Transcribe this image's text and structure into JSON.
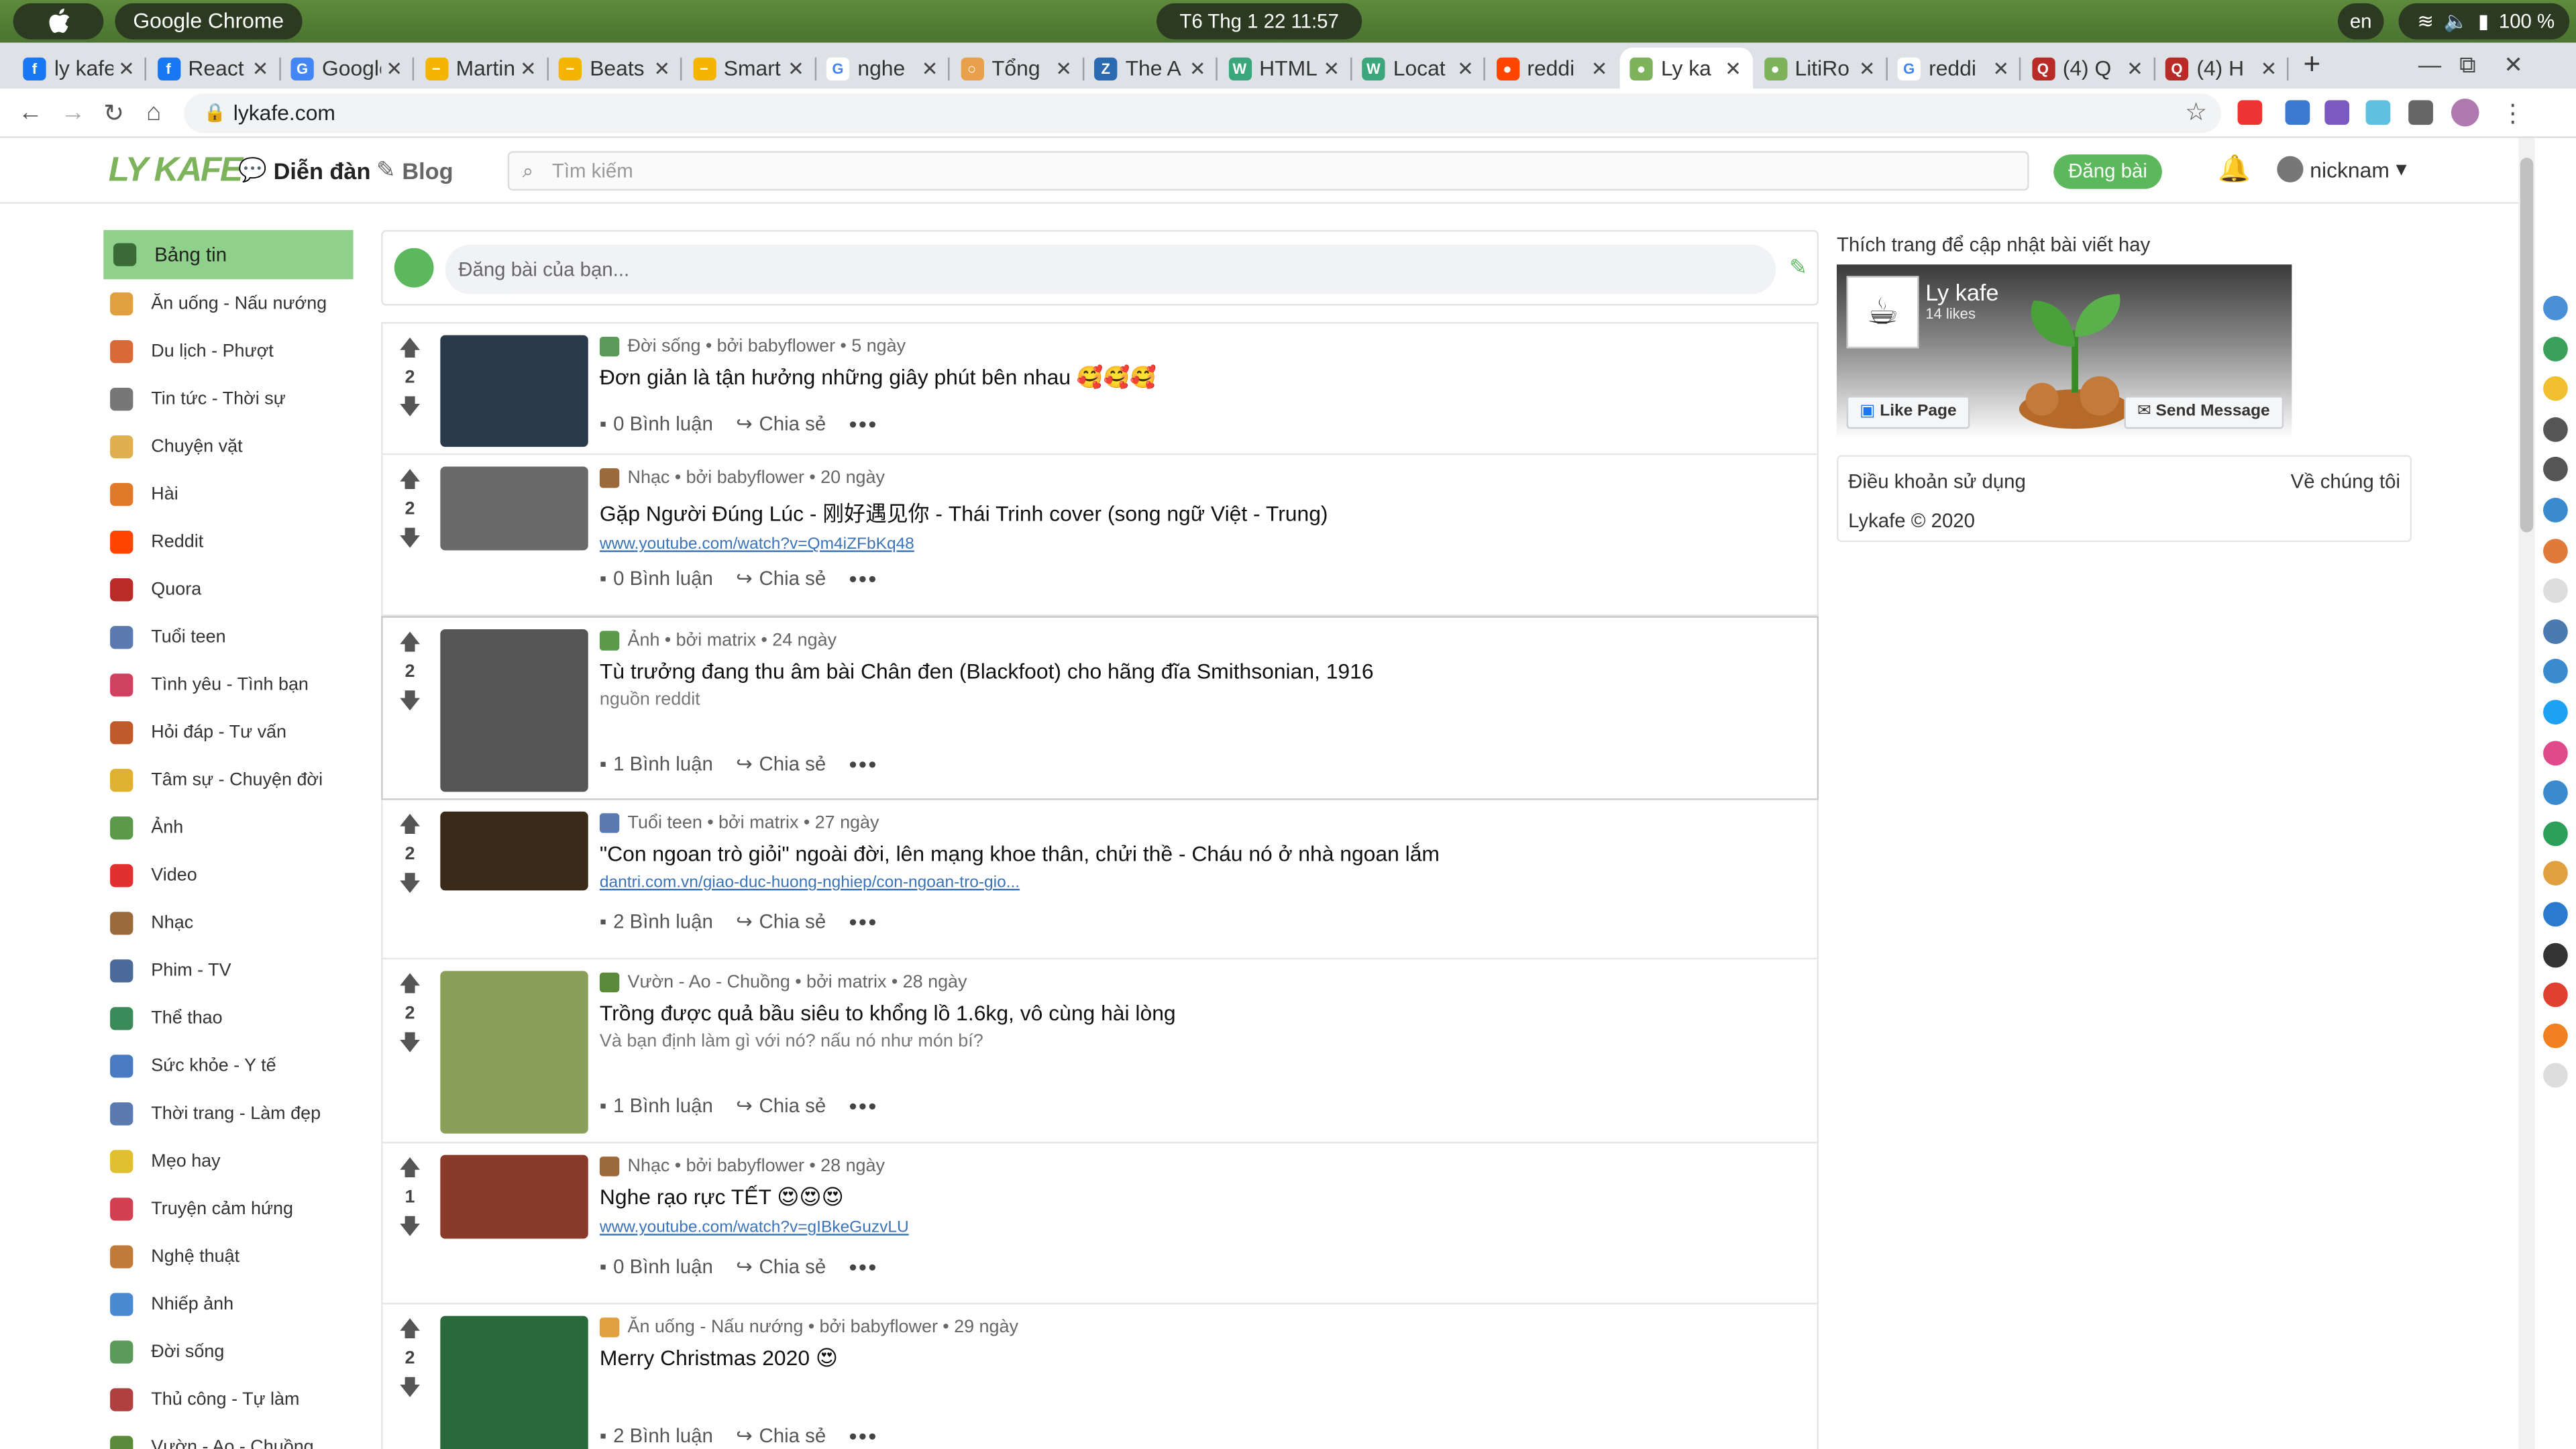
{
  "system": {
    "app_name": "Google Chrome",
    "clock": "T6 Thg 1 22  11:57",
    "lang": "en",
    "battery": "100 %"
  },
  "tabs": [
    {
      "title": "ly kafe",
      "color": "#1877f2",
      "glyph": "f"
    },
    {
      "title": "React",
      "color": "#1877f2",
      "glyph": "f"
    },
    {
      "title": "Google",
      "color": "#4285f4",
      "glyph": "G"
    },
    {
      "title": "Martin",
      "color": "#f5b400",
      "glyph": "−"
    },
    {
      "title": "Beats",
      "color": "#f5b400",
      "glyph": "−"
    },
    {
      "title": "Smart",
      "color": "#f5b400",
      "glyph": "−"
    },
    {
      "title": "nghe",
      "color": "#ffffff",
      "glyph": "G"
    },
    {
      "title": "Tổng",
      "color": "#e8a04a",
      "glyph": "○"
    },
    {
      "title": "The A",
      "color": "#2a6ab0",
      "glyph": "Z"
    },
    {
      "title": "HTML",
      "color": "#3aa77a",
      "glyph": "W"
    },
    {
      "title": "Locat",
      "color": "#3aa77a",
      "glyph": "W"
    },
    {
      "title": "reddi",
      "color": "#ff4500",
      "glyph": "●"
    },
    {
      "title": "Ly ka",
      "color": "#7cb35b",
      "glyph": "●"
    },
    {
      "title": "LitiRo",
      "color": "#7cb35b",
      "glyph": "●"
    },
    {
      "title": "reddi",
      "color": "#ffffff",
      "glyph": "G"
    },
    {
      "title": "(4) Q",
      "color": "#b92b27",
      "glyph": "Q"
    },
    {
      "title": "(4) H",
      "color": "#b92b27",
      "glyph": "Q"
    }
  ],
  "address": {
    "url": "lykafe.com"
  },
  "site": {
    "logo": "LY KAFE",
    "nav_forum": "Diễn đàn",
    "nav_blog": "Blog",
    "search_placeholder": "Tìm kiếm",
    "post_button": "Đăng bài",
    "username": "nicknam",
    "composer_placeholder": "Đăng bài của bạn...",
    "accent": "#7cb35b"
  },
  "sidebar": [
    {
      "label": "Bảng tin",
      "color": "#3a6b36"
    },
    {
      "label": "Ăn uống - Nấu nướng",
      "color": "#e0a040"
    },
    {
      "label": "Du lịch - Phượt",
      "color": "#d86a3a"
    },
    {
      "label": "Tin tức - Thời sự",
      "color": "#777777"
    },
    {
      "label": "Chuyện vặt",
      "color": "#e0b050"
    },
    {
      "label": "Hài",
      "color": "#e07a2a"
    },
    {
      "label": "Reddit",
      "color": "#ff4500"
    },
    {
      "label": "Quora",
      "color": "#b92b27"
    },
    {
      "label": "Tuổi teen",
      "color": "#5a7ab0"
    },
    {
      "label": "Tình yêu - Tình bạn",
      "color": "#d04060"
    },
    {
      "label": "Hỏi đáp - Tư vấn",
      "color": "#c05a2a"
    },
    {
      "label": "Tâm sự - Chuyện đời",
      "color": "#e0b030"
    },
    {
      "label": "Ảnh",
      "color": "#5a9a4a"
    },
    {
      "label": "Video",
      "color": "#e03030"
    },
    {
      "label": "Nhạc",
      "color": "#9a6a3a"
    },
    {
      "label": "Phim - TV",
      "color": "#4a6a9a"
    },
    {
      "label": "Thể thao",
      "color": "#3a8a5a"
    },
    {
      "label": "Sức khỏe - Y tế",
      "color": "#4a7ac0"
    },
    {
      "label": "Thời trang - Làm đẹp",
      "color": "#5a7ab0"
    },
    {
      "label": "Mẹo hay",
      "color": "#e0c030"
    },
    {
      "label": "Truyện cảm hứng",
      "color": "#d04050"
    },
    {
      "label": "Nghệ thuật",
      "color": "#c07a3a"
    },
    {
      "label": "Nhiếp ảnh",
      "color": "#4a8ad0"
    },
    {
      "label": "Đời sống",
      "color": "#5a9a5a"
    },
    {
      "label": "Thủ công - Tự làm",
      "color": "#b04040"
    },
    {
      "label": "Vườn - Ao - Chuồng",
      "color": "#5a8a3a"
    }
  ],
  "posts": [
    {
      "votes": "2",
      "category": "Đời sống",
      "author": "bởi babyflower",
      "age": "5 ngày",
      "title": "Đơn giản là tận hưởng những giây phút bên nhau 🥰🥰🥰",
      "link": "",
      "desc": "",
      "comments": "0 Bình luận",
      "share": "Chia sẻ",
      "thumb": "#2a3a4a"
    },
    {
      "votes": "2",
      "category": "Nhạc",
      "author": "bởi babyflower",
      "age": "20 ngày",
      "title": "Gặp Người Đúng Lúc - 刚好遇见你 - Thái Trinh cover (song ngữ Việt - Trung)",
      "link": "www.youtube.com/watch?v=Qm4iZFbKq48",
      "desc": "",
      "comments": "0 Bình luận",
      "share": "Chia sẻ",
      "thumb": "#6a6a6a"
    },
    {
      "votes": "2",
      "category": "Ảnh",
      "author": "bởi matrix",
      "age": "24 ngày",
      "title": "Tù trưởng đang thu âm bài Chân đen (Blackfoot) cho hãng đĩa Smithsonian, 1916",
      "link": "",
      "desc": "nguồn reddit",
      "comments": "1 Bình luận",
      "share": "Chia sẻ",
      "thumb": "#555555"
    },
    {
      "votes": "2",
      "category": "Tuổi teen",
      "author": "bởi matrix",
      "age": "27 ngày",
      "title": "\"Con ngoan trò giỏi\" ngoài đời, lên mạng khoe thân, chửi thề - Cháu nó ở nhà ngoan lắm",
      "link": "dantri.com.vn/giao-duc-huong-nghiep/con-ngoan-tro-gio...",
      "desc": "",
      "comments": "2 Bình luận",
      "share": "Chia sẻ",
      "thumb": "#3a2a1a"
    },
    {
      "votes": "2",
      "category": "Vườn - Ao - Chuồng",
      "author": "bởi matrix",
      "age": "28 ngày",
      "title": "Trồng được quả bầu siêu to khổng lồ 1.6kg, vô cùng hài lòng",
      "link": "",
      "desc": "Và bạn định làm gì với nó? nấu nó như món bí?",
      "comments": "1 Bình luận",
      "share": "Chia sẻ",
      "thumb": "#8aa05a"
    },
    {
      "votes": "1",
      "category": "Nhạc",
      "author": "bởi babyflower",
      "age": "28 ngày",
      "title": "Nghe rạo rực TẾT 😍😍😍",
      "link": "www.youtube.com/watch?v=gIBkeGuzvLU",
      "desc": "",
      "comments": "0 Bình luận",
      "share": "Chia sẻ",
      "thumb": "#8a3a2a"
    },
    {
      "votes": "2",
      "category": "Ăn uống - Nấu nướng",
      "author": "bởi babyflower",
      "age": "29 ngày",
      "title": "Merry Christmas 2020 😍",
      "link": "",
      "desc": "",
      "comments": "2 Bình luận",
      "share": "Chia sẻ",
      "thumb": "#2a6a3a"
    }
  ],
  "right": {
    "heading": "Thích trang để cập nhật bài viết hay",
    "fb_name": "Ly kafe",
    "fb_likes": "14 likes",
    "fb_like_btn": "Like Page",
    "fb_msg_btn": "Send Message",
    "terms": "Điều khoản sử dụng",
    "about": "Về chúng tôi",
    "copyright": "Lykafe © 2020"
  }
}
